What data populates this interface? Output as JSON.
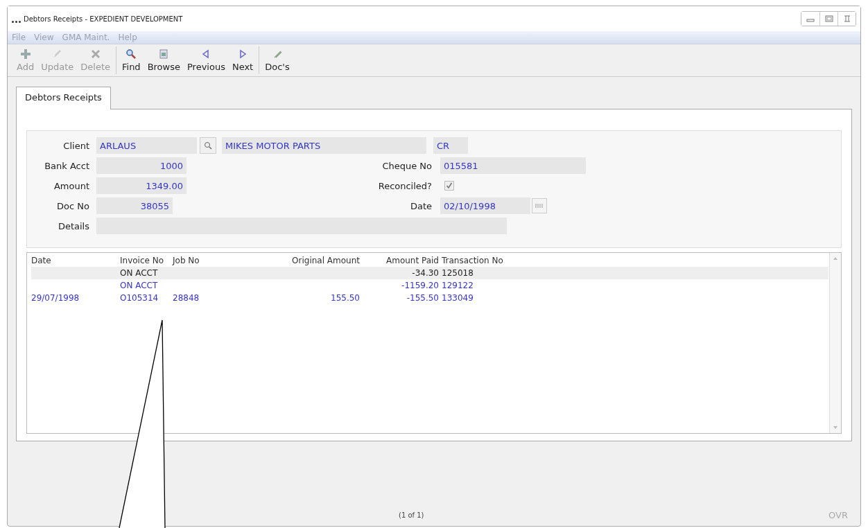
{
  "window": {
    "title": "Debtors Receipts - EXPEDIENT DEVELOPMENT"
  },
  "menu": [
    {
      "label": "File"
    },
    {
      "label": "View"
    },
    {
      "label": "GMA Maint."
    },
    {
      "label": "Help"
    }
  ],
  "toolbar": [
    {
      "label": "Add",
      "disabled": true
    },
    {
      "label": "Update",
      "disabled": true
    },
    {
      "label": "Delete",
      "disabled": true
    },
    {
      "label": "Find",
      "disabled": false
    },
    {
      "label": "Browse",
      "disabled": false
    },
    {
      "label": "Previous",
      "disabled": false
    },
    {
      "label": "Next",
      "disabled": false
    },
    {
      "label": "Doc's",
      "disabled": false
    }
  ],
  "tabs": [
    {
      "label": "Debtors Receipts",
      "selected": true
    }
  ],
  "form": {
    "client": {
      "label": "Client",
      "code": "ARLAUS",
      "name": "MIKES MOTOR PARTS",
      "type": "CR"
    },
    "bank_acct": {
      "label": "Bank Acct",
      "value": "1000"
    },
    "cheque_no": {
      "label": "Cheque No",
      "value": "015581"
    },
    "amount": {
      "label": "Amount",
      "value": "1349.00"
    },
    "reconciled": {
      "label": "Reconciled?",
      "checked": true
    },
    "doc_no": {
      "label": "Doc No",
      "value": "38055"
    },
    "date": {
      "label": "Date",
      "value": "02/10/1998"
    },
    "details": {
      "label": "Details"
    }
  },
  "table": {
    "columns": [
      "Date",
      "Invoice No",
      "Job No",
      "Original Amount",
      "Amount Paid",
      "Transaction No"
    ],
    "rows": [
      {
        "cells": [
          "",
          "ON ACCT",
          "",
          "",
          "-34.30",
          "125018"
        ],
        "selected": true
      },
      {
        "cells": [
          "",
          "ON ACCT",
          "",
          "",
          "-1159.20",
          "129122"
        ],
        "selected": false
      },
      {
        "cells": [
          "29/07/1998",
          "O105314",
          "28848",
          "155.50",
          "-155.50",
          "133049"
        ],
        "selected": false
      }
    ]
  },
  "status_bar": {
    "record": "(1 of 1)",
    "mode": "OVR"
  }
}
